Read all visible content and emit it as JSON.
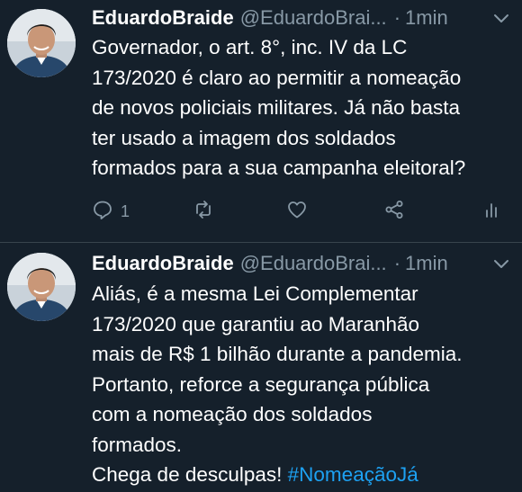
{
  "tweets": [
    {
      "author_name": "EduardoBraide",
      "handle": "@EduardoBrai...",
      "separator": "·",
      "time": "1min",
      "text_lines": [
        "Governador, o art. 8°, inc. IV da LC",
        "173/2020 é claro ao permitir a nomeação",
        "de novos policiais militares. Já não basta",
        "ter usado a imagem dos soldados",
        "formados para a sua campanha eleitoral?"
      ],
      "reply_count": "1"
    },
    {
      "author_name": "EduardoBraide",
      "handle": "@EduardoBrai...",
      "separator": "·",
      "time": "1min",
      "text_lines": [
        "Aliás, é a mesma Lei Complementar",
        "173/2020 que garantiu ao Maranhão",
        "mais de R$ 1 bilhão durante a pandemia.",
        "Portanto, reforce a segurança pública",
        "com a nomeação dos soldados",
        "formados."
      ],
      "last_line_text": "Chega de desculpas! ",
      "hashtag": "#NomeaçãoJá"
    }
  ],
  "icons": [
    "chevron-down-icon",
    "reply-icon",
    "retweet-icon",
    "like-icon",
    "share-icon",
    "analytics-icon"
  ],
  "colors": {
    "background": "#15202b",
    "text": "#ffffff",
    "secondary": "#8899a6",
    "link": "#1da1f2",
    "divider": "#38444d"
  }
}
